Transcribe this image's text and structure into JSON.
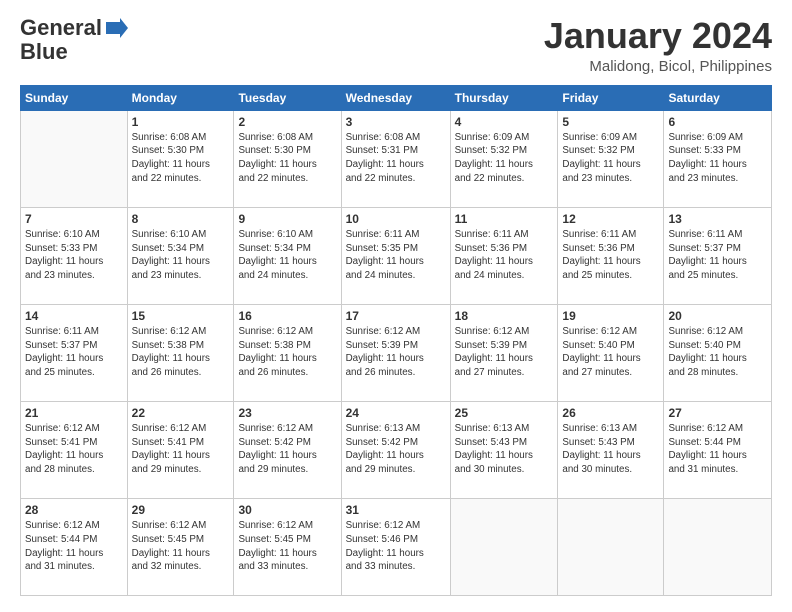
{
  "logo": {
    "general": "General",
    "blue": "Blue"
  },
  "header": {
    "month": "January 2024",
    "location": "Malidong, Bicol, Philippines"
  },
  "weekdays": [
    "Sunday",
    "Monday",
    "Tuesday",
    "Wednesday",
    "Thursday",
    "Friday",
    "Saturday"
  ],
  "weeks": [
    [
      {
        "day": "",
        "info": ""
      },
      {
        "day": "1",
        "info": "Sunrise: 6:08 AM\nSunset: 5:30 PM\nDaylight: 11 hours\nand 22 minutes."
      },
      {
        "day": "2",
        "info": "Sunrise: 6:08 AM\nSunset: 5:30 PM\nDaylight: 11 hours\nand 22 minutes."
      },
      {
        "day": "3",
        "info": "Sunrise: 6:08 AM\nSunset: 5:31 PM\nDaylight: 11 hours\nand 22 minutes."
      },
      {
        "day": "4",
        "info": "Sunrise: 6:09 AM\nSunset: 5:32 PM\nDaylight: 11 hours\nand 22 minutes."
      },
      {
        "day": "5",
        "info": "Sunrise: 6:09 AM\nSunset: 5:32 PM\nDaylight: 11 hours\nand 23 minutes."
      },
      {
        "day": "6",
        "info": "Sunrise: 6:09 AM\nSunset: 5:33 PM\nDaylight: 11 hours\nand 23 minutes."
      }
    ],
    [
      {
        "day": "7",
        "info": "Sunrise: 6:10 AM\nSunset: 5:33 PM\nDaylight: 11 hours\nand 23 minutes."
      },
      {
        "day": "8",
        "info": "Sunrise: 6:10 AM\nSunset: 5:34 PM\nDaylight: 11 hours\nand 23 minutes."
      },
      {
        "day": "9",
        "info": "Sunrise: 6:10 AM\nSunset: 5:34 PM\nDaylight: 11 hours\nand 24 minutes."
      },
      {
        "day": "10",
        "info": "Sunrise: 6:11 AM\nSunset: 5:35 PM\nDaylight: 11 hours\nand 24 minutes."
      },
      {
        "day": "11",
        "info": "Sunrise: 6:11 AM\nSunset: 5:36 PM\nDaylight: 11 hours\nand 24 minutes."
      },
      {
        "day": "12",
        "info": "Sunrise: 6:11 AM\nSunset: 5:36 PM\nDaylight: 11 hours\nand 25 minutes."
      },
      {
        "day": "13",
        "info": "Sunrise: 6:11 AM\nSunset: 5:37 PM\nDaylight: 11 hours\nand 25 minutes."
      }
    ],
    [
      {
        "day": "14",
        "info": "Sunrise: 6:11 AM\nSunset: 5:37 PM\nDaylight: 11 hours\nand 25 minutes."
      },
      {
        "day": "15",
        "info": "Sunrise: 6:12 AM\nSunset: 5:38 PM\nDaylight: 11 hours\nand 26 minutes."
      },
      {
        "day": "16",
        "info": "Sunrise: 6:12 AM\nSunset: 5:38 PM\nDaylight: 11 hours\nand 26 minutes."
      },
      {
        "day": "17",
        "info": "Sunrise: 6:12 AM\nSunset: 5:39 PM\nDaylight: 11 hours\nand 26 minutes."
      },
      {
        "day": "18",
        "info": "Sunrise: 6:12 AM\nSunset: 5:39 PM\nDaylight: 11 hours\nand 27 minutes."
      },
      {
        "day": "19",
        "info": "Sunrise: 6:12 AM\nSunset: 5:40 PM\nDaylight: 11 hours\nand 27 minutes."
      },
      {
        "day": "20",
        "info": "Sunrise: 6:12 AM\nSunset: 5:40 PM\nDaylight: 11 hours\nand 28 minutes."
      }
    ],
    [
      {
        "day": "21",
        "info": "Sunrise: 6:12 AM\nSunset: 5:41 PM\nDaylight: 11 hours\nand 28 minutes."
      },
      {
        "day": "22",
        "info": "Sunrise: 6:12 AM\nSunset: 5:41 PM\nDaylight: 11 hours\nand 29 minutes."
      },
      {
        "day": "23",
        "info": "Sunrise: 6:12 AM\nSunset: 5:42 PM\nDaylight: 11 hours\nand 29 minutes."
      },
      {
        "day": "24",
        "info": "Sunrise: 6:13 AM\nSunset: 5:42 PM\nDaylight: 11 hours\nand 29 minutes."
      },
      {
        "day": "25",
        "info": "Sunrise: 6:13 AM\nSunset: 5:43 PM\nDaylight: 11 hours\nand 30 minutes."
      },
      {
        "day": "26",
        "info": "Sunrise: 6:13 AM\nSunset: 5:43 PM\nDaylight: 11 hours\nand 30 minutes."
      },
      {
        "day": "27",
        "info": "Sunrise: 6:12 AM\nSunset: 5:44 PM\nDaylight: 11 hours\nand 31 minutes."
      }
    ],
    [
      {
        "day": "28",
        "info": "Sunrise: 6:12 AM\nSunset: 5:44 PM\nDaylight: 11 hours\nand 31 minutes."
      },
      {
        "day": "29",
        "info": "Sunrise: 6:12 AM\nSunset: 5:45 PM\nDaylight: 11 hours\nand 32 minutes."
      },
      {
        "day": "30",
        "info": "Sunrise: 6:12 AM\nSunset: 5:45 PM\nDaylight: 11 hours\nand 33 minutes."
      },
      {
        "day": "31",
        "info": "Sunrise: 6:12 AM\nSunset: 5:46 PM\nDaylight: 11 hours\nand 33 minutes."
      },
      {
        "day": "",
        "info": ""
      },
      {
        "day": "",
        "info": ""
      },
      {
        "day": "",
        "info": ""
      }
    ]
  ]
}
